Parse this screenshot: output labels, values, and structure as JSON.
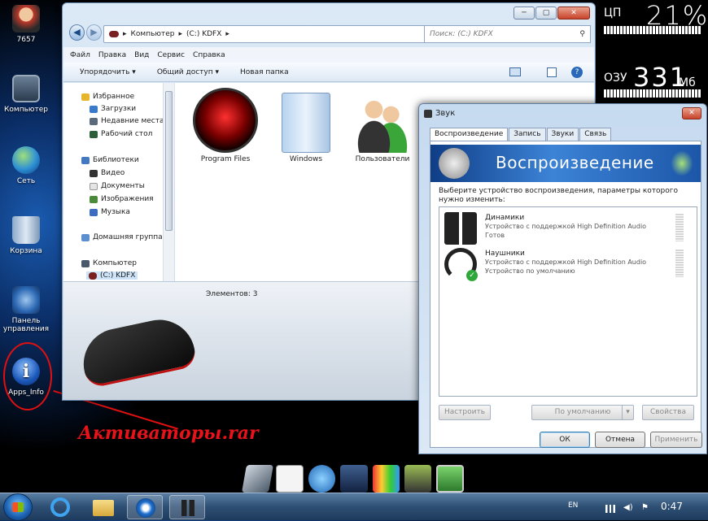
{
  "desktop": {
    "icons": [
      {
        "label": "7657",
        "icon": "user-icon"
      },
      {
        "label": "Компьютер",
        "icon": "computer-icon"
      },
      {
        "label": "Сеть",
        "icon": "network-icon"
      },
      {
        "label": "Корзина",
        "icon": "recycle-bin-icon"
      },
      {
        "label": "Панель управления",
        "icon": "control-panel-icon"
      },
      {
        "label": "Apps_Info",
        "icon": "info-icon"
      }
    ],
    "annotation": "Активаторы.rar"
  },
  "gauges": {
    "cpu_label": "ЦП",
    "cpu_value": "21%",
    "ram_label": "ОЗУ",
    "ram_value": "331",
    "ram_unit": "Мб"
  },
  "explorer": {
    "address": [
      "Компьютер",
      "(C:) KDFX"
    ],
    "search_placeholder": "Поиск: (C:) KDFX",
    "menu": [
      "Файл",
      "Правка",
      "Вид",
      "Сервис",
      "Справка"
    ],
    "toolbar": {
      "organize": "Упорядочить ▾",
      "share": "Общий доступ ▾",
      "new_folder": "Новая папка"
    },
    "nav": {
      "favorites": "Избранное",
      "downloads": "Загрузки",
      "recent": "Недавние места",
      "desktop": "Рабочий стол",
      "libraries": "Библиотеки",
      "video": "Видео",
      "documents": "Документы",
      "images": "Изображения",
      "music": "Музыка",
      "homegroup": "Домашняя группа",
      "computer": "Компьютер",
      "drive": "(C:) KDFX"
    },
    "items": [
      "Program Files",
      "Windows",
      "Пользователи"
    ],
    "status": "Элементов: 3",
    "colors": {
      "accent": "#1e5aa8"
    }
  },
  "sound": {
    "title": "Звук",
    "tabs": [
      "Воспроизведение",
      "Запись",
      "Звуки",
      "Связь"
    ],
    "banner": "Воспроизведение",
    "description": "Выберите устройство воспроизведения, параметры которого нужно изменить:",
    "devices": [
      {
        "name": "Динамики",
        "desc": "Устройство с поддержкой High Definition Audio",
        "status": "Готов",
        "icon": "speakers-icon"
      },
      {
        "name": "Наушники",
        "desc": "Устройство с поддержкой High Definition Audio",
        "status": "Устройство по умолчанию",
        "icon": "headphones-icon"
      }
    ],
    "buttons": {
      "configure": "Настроить",
      "default": "По умолчанию",
      "properties": "Свойства",
      "ok": "ОК",
      "cancel": "Отмена",
      "apply": "Применить"
    }
  },
  "taskbar": {
    "lang": "EN",
    "clock": "0:47"
  }
}
